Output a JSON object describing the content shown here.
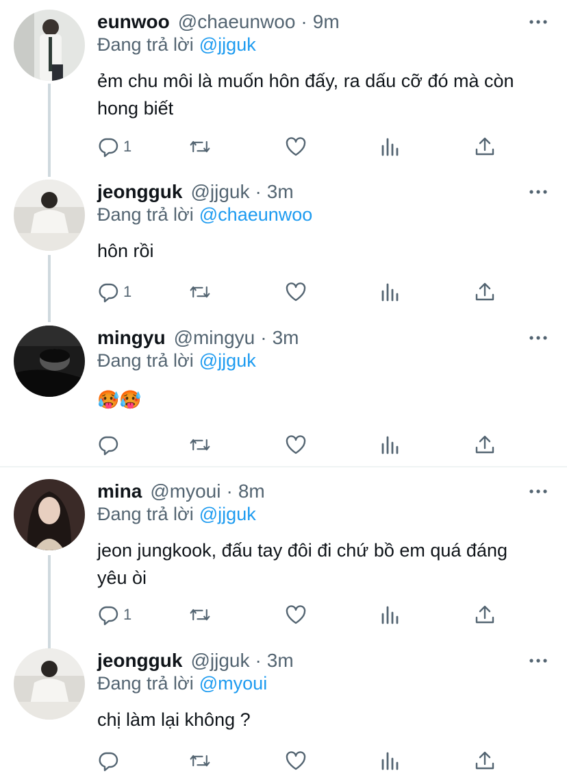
{
  "colors": {
    "accent": "#1d9bf0",
    "muted": "#536471",
    "text": "#0f1419",
    "line": "#cfd9de"
  },
  "reply_prefix": "Đang trả lời",
  "tweets": [
    {
      "name": "eunwoo",
      "handle": "@chaeunwoo",
      "time": "9m",
      "reply_to": "@jjguk",
      "text": "ẻm chu môi là muốn hôn đấy, ra dấu cỡ đó mà còn hong biết",
      "reply_count": "1"
    },
    {
      "name": "jeongguk",
      "handle": "@jjguk",
      "time": "3m",
      "reply_to": "@chaeunwoo",
      "text": "hôn rồi",
      "reply_count": "1"
    },
    {
      "name": "mingyu",
      "handle": "@mingyu",
      "time": "3m",
      "reply_to": "@jjguk",
      "text": "🥵🥵",
      "reply_count": ""
    },
    {
      "name": "mina",
      "handle": "@myoui",
      "time": "8m",
      "reply_to": "@jjguk",
      "text": "jeon jungkook, đấu tay đôi đi chứ bồ em quá đáng yêu òi",
      "reply_count": "1"
    },
    {
      "name": "jeongguk",
      "handle": "@jjguk",
      "time": "3m",
      "reply_to": "@myoui",
      "text": "chị làm lại không ?",
      "reply_count": ""
    }
  ],
  "icons": [
    "more-icon",
    "reply-icon",
    "retweet-icon",
    "like-icon",
    "analytics-icon",
    "share-icon"
  ]
}
